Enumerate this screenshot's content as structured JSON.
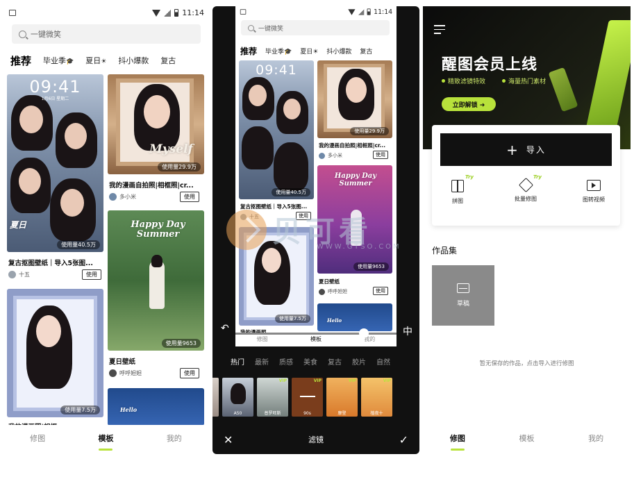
{
  "status": {
    "time": "11:14"
  },
  "panel1": {
    "search_placeholder": "一键微笑",
    "categories": [
      "推荐",
      "毕业季",
      "夏日",
      "抖小爆款",
      "复古"
    ],
    "cards": [
      {
        "title": "复古抠图壁纸｜导入5张图...",
        "author": "十五",
        "usage": "使用量40.5万",
        "button": "使用",
        "clock": "09:41",
        "clock_sub": "1月6日 星期二",
        "overlay": "夏日"
      },
      {
        "title": "我的漫画自拍照|相框照|cr...",
        "author": "多小米",
        "usage": "使用量29.9万",
        "button": "使用",
        "overlay": "Myself"
      },
      {
        "title": "夏日壁纸",
        "author": "呼呼妲妲",
        "usage": "使用量9653",
        "button": "使用",
        "overlay": "Happy Day Summer"
      },
      {
        "title": "我的漫画照|相框...",
        "usage": "使用量7.5万"
      },
      {
        "overlay": "Hello"
      }
    ],
    "nav": [
      "修图",
      "模板",
      "我的"
    ],
    "nav_active": "模板"
  },
  "panel2": {
    "search_placeholder": "一键微笑",
    "categories": [
      "推荐",
      "毕业季",
      "夏日",
      "抖小爆款",
      "复古"
    ],
    "cards": [
      {
        "title": "复古抠图壁纸｜导入5张图...",
        "author": "十五",
        "usage": "使用量40.5万",
        "button": "使用",
        "clock": "09:41"
      },
      {
        "title": "我的漫画自拍照|相框照|cr...",
        "author": "多小米",
        "usage": "使用量29.9万",
        "button": "使用"
      },
      {
        "title": "夏日壁纸",
        "author": "呼呼妲妲",
        "usage": "使用量9653",
        "button": "使用",
        "overlay": "Happy Day Summer"
      },
      {
        "title": "我的漫画照...",
        "usage": "使用量7.5万"
      },
      {
        "overlay": "Hello"
      }
    ],
    "nav": [
      "修图",
      "模板",
      "我的"
    ],
    "filters": [
      "热门",
      "最新",
      "质感",
      "美食",
      "复古",
      "胶片",
      "自然"
    ],
    "filter_active": "热门",
    "filter_thumbs": [
      {
        "label": "",
        "vip": false
      },
      {
        "label": "A50",
        "vip": false
      },
      {
        "label": "普罗旺斯",
        "vip": true
      },
      {
        "label": "90s",
        "vip": true
      },
      {
        "label": "摩登",
        "vip": true
      },
      {
        "label": "植夜十",
        "vip": true
      }
    ],
    "vip_tag": "VIP",
    "title": "滤镜",
    "side_left": "↶",
    "side_right": "中"
  },
  "panel3": {
    "banner_title": "醒图会员上线",
    "features": [
      "精致滤镜特效",
      "海量热门素材"
    ],
    "unlock_label": "立即解锁 ➜",
    "import_label": "导入",
    "tools": [
      {
        "label": "拼图",
        "icon": "collage-icon",
        "try": "Try"
      },
      {
        "label": "批量修图",
        "icon": "batch-edit-icon",
        "try": "Try"
      },
      {
        "label": "图转视频",
        "icon": "video-icon",
        "try": ""
      }
    ],
    "works_title": "作品集",
    "draft_label": "草稿",
    "empty_note": "暂无保存的作品，点击导入进行修图",
    "nav": [
      "修图",
      "模板",
      "我的"
    ],
    "nav_active": "修图"
  },
  "watermark": {
    "text": "贝可看",
    "sub": "WWW.GTSO.COM"
  },
  "colors": {
    "accent": "#b8e23b",
    "dark": "#111111",
    "watermark_orange": "#e7a055"
  }
}
